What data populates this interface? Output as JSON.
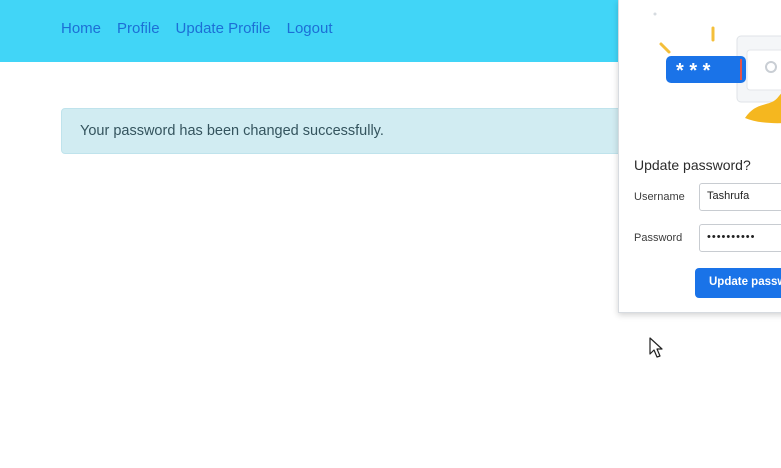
{
  "nav": {
    "links": [
      "Home",
      "Profile",
      "Update Profile",
      "Logout"
    ]
  },
  "alert": {
    "message": "Your password has been changed successfully."
  },
  "password_prompt": {
    "title": "Update password?",
    "username_label": "Username",
    "username_value": "Tashrufa",
    "password_label": "Password",
    "password_value": "••••••••••",
    "button_label": "Update password",
    "illustration_mask": "* * *"
  },
  "colors": {
    "navbar": "#41d5f7",
    "nav_link": "#1c6fd6",
    "alert_bg": "#d1ecf2",
    "primary_button": "#1a73e8"
  }
}
